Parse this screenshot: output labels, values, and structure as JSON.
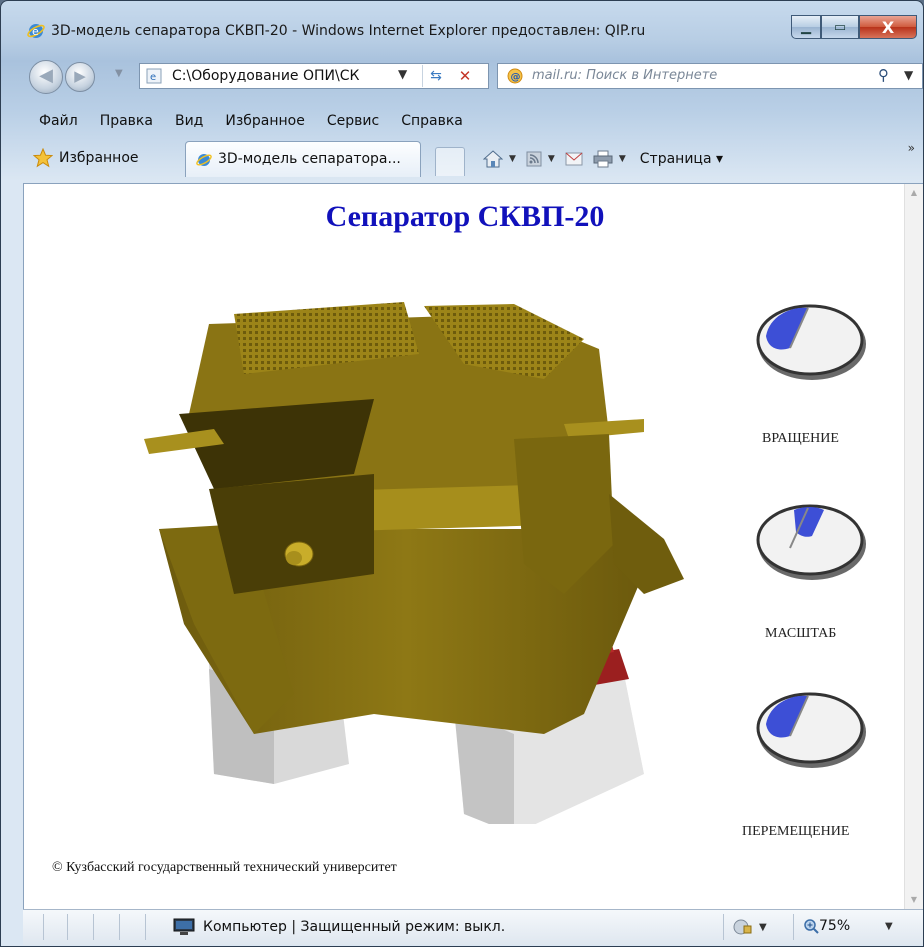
{
  "window": {
    "title": "3D-модель сепаратора СКВП-20 - Windows Internet Explorer предоставлен: QIP.ru",
    "close_label": "X"
  },
  "address": {
    "url": "C:\\Оборудование ОПИ\\СК",
    "search_placeholder": "mail.ru: Поиск в Интернете"
  },
  "menu": {
    "items": [
      "Файл",
      "Правка",
      "Вид",
      "Избранное",
      "Сервис",
      "Справка"
    ]
  },
  "tabbar": {
    "favorites_label": "Избранное",
    "tab_label": "3D-модель сепаратора...",
    "page_menu_label": "Страница ▾"
  },
  "page": {
    "title": "Сепаратор СКВП-20",
    "controls": [
      {
        "label": "ВРАЩЕНИЕ",
        "button": "left"
      },
      {
        "label": "МАСШТАБ",
        "button": "middle"
      },
      {
        "label": "ПЕРЕМЕЩЕНИЕ",
        "button": "right"
      }
    ],
    "copyright": "© Кузбасский государственный технический университет"
  },
  "status": {
    "zone_text": "Компьютер | Защищенный режим: выкл.",
    "zoom": "75%"
  },
  "colors": {
    "title_blue": "#1111bb",
    "model_olive": "#8a7414",
    "model_olive_light": "#a68e1c",
    "support_red": "#9b1f1f",
    "mouse_highlight": "#3d4fd6"
  },
  "icons": [
    "ie-icon",
    "back-icon",
    "forward-icon",
    "refresh-icon",
    "stop-icon",
    "search-icon",
    "favorites-star-icon",
    "home-icon",
    "feeds-icon",
    "mail-icon",
    "print-icon",
    "computer-icon",
    "zoom-icon"
  ]
}
